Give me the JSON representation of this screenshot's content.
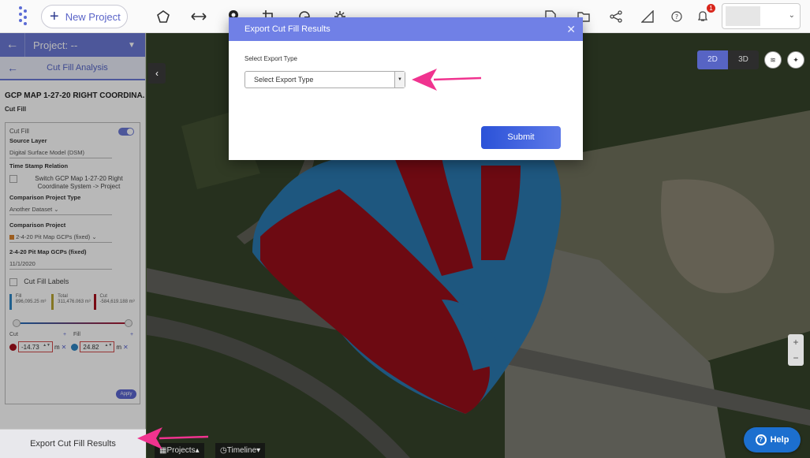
{
  "topbar": {
    "new_project_label": "New Project",
    "notification_count": "1"
  },
  "panel": {
    "project_title": "Project: --",
    "analysis_title": "Cut Fill Analysis",
    "dataset_title": "GCP MAP 1-27-20 RIGHT COORDINA...",
    "section_label": "Cut Fill",
    "card": {
      "cut_fill_label": "Cut Fill",
      "source_layer_label": "Source Layer",
      "source_layer_value": "Digital Surface Model (DSM)",
      "time_stamp_label": "Time Stamp Relation",
      "switch_label": "Switch GCP Map 1-27-20 Right Coordinate System -> Project",
      "comparison_type_label": "Comparison Project Type",
      "comparison_type_value": "Another Dataset",
      "comparison_project_label": "Comparison Project",
      "comparison_project_value": "2-4-20 Pit Map GCPs (fixed)",
      "fixed_label": "2-4-20 Pit Map GCPs (fixed)",
      "date_value": "11/1/2020",
      "labels_checkbox": "Cut Fill Labels",
      "fill_title": "Fill",
      "fill_value": "896,095.25 m³",
      "total_title": "Total",
      "total_value": "311,476.063 m³",
      "cut_title": "Cut",
      "cut_value": "-584,619.188 m³",
      "cut_label": "Cut",
      "fill_label": "Fill",
      "cut_input": "-14.73",
      "fill_input": "24.82",
      "unit": "m",
      "apply_label": "Apply"
    },
    "export_footer": "Export Cut Fill Results"
  },
  "map": {
    "toggle_2d": "2D",
    "toggle_3d": "3D",
    "zoom_in": "+",
    "zoom_out": "−",
    "projects_label": "Projects",
    "timeline_label": "Timeline",
    "help_label": "Help"
  },
  "modal": {
    "title": "Export Cut Fill Results",
    "select_label": "Select Export Type",
    "select_placeholder": "Select Export Type",
    "submit_label": "Submit"
  },
  "colors": {
    "accent": "#7080e6",
    "fill_blue": "#2f86c4",
    "cut_red": "#a8101c",
    "arrow_pink": "#f0338f"
  }
}
